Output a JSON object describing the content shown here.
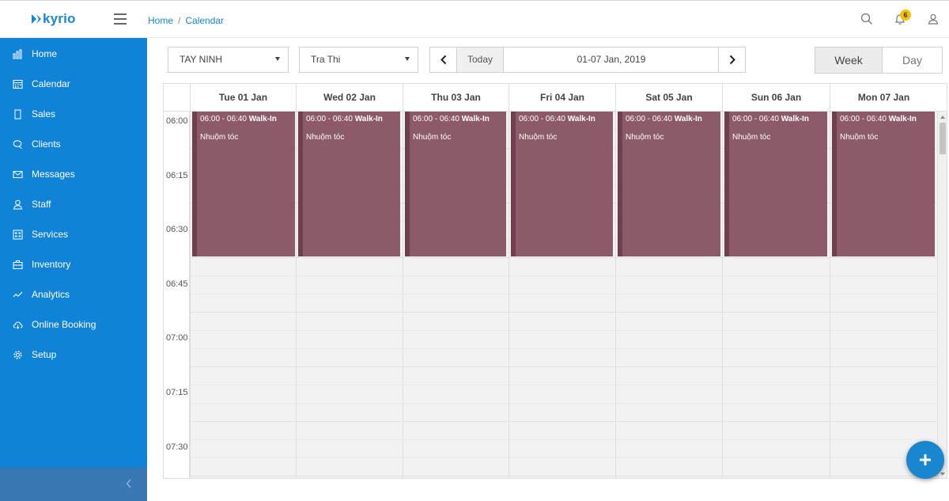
{
  "app": {
    "logo_text": "kyrio",
    "brand_color": "#1183d7"
  },
  "breadcrumb": {
    "home": "Home",
    "separator": "/",
    "current": "Calendar"
  },
  "header": {
    "notification_count": "6",
    "icons": [
      "search-icon",
      "bell-icon",
      "user-icon"
    ]
  },
  "sidebar": {
    "items": [
      {
        "label": "Home",
        "icon": "bar-chart-icon"
      },
      {
        "label": "Calendar",
        "icon": "calendar-icon"
      },
      {
        "label": "Sales",
        "icon": "receipt-icon"
      },
      {
        "label": "Clients",
        "icon": "chat-icon"
      },
      {
        "label": "Messages",
        "icon": "envelope-icon"
      },
      {
        "label": "Staff",
        "icon": "person-icon"
      },
      {
        "label": "Services",
        "icon": "grid-icon"
      },
      {
        "label": "Inventory",
        "icon": "briefcase-icon"
      },
      {
        "label": "Analytics",
        "icon": "trend-icon"
      },
      {
        "label": "Online Booking",
        "icon": "cloud-icon"
      },
      {
        "label": "Setup",
        "icon": "gear-icon"
      }
    ]
  },
  "toolbar": {
    "location": "TAY NINH",
    "staff": "Tra Thi",
    "today": "Today",
    "date_range": "01-07 Jan, 2019",
    "view_week": "Week",
    "view_day": "Day"
  },
  "calendar": {
    "days": [
      "Tue 01 Jan",
      "Wed 02 Jan",
      "Thu 03 Jan",
      "Fri 04 Jan",
      "Sat 05 Jan",
      "Sun 06 Jan",
      "Mon 07 Jan"
    ],
    "times": [
      "06:00",
      "06:15",
      "06:30",
      "06:45",
      "07:00",
      "07:15",
      "07:30"
    ],
    "appointment": {
      "time": "06:00 - 06:40",
      "type": "Walk-In",
      "service": "Nhuộm tóc",
      "color": "#8c5a68"
    }
  }
}
